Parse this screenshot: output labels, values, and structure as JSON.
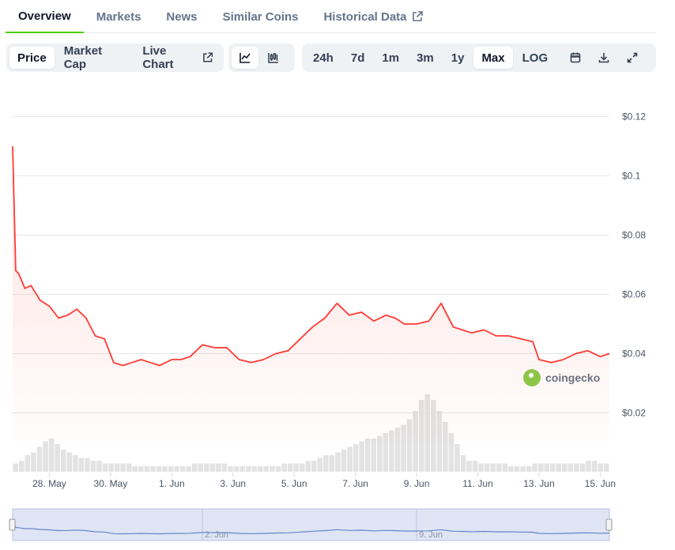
{
  "tabs": [
    {
      "label": "Overview",
      "active": true
    },
    {
      "label": "Markets"
    },
    {
      "label": "News"
    },
    {
      "label": "Similar Coins"
    },
    {
      "label": "Historical Data",
      "external": true
    }
  ],
  "toolbar": {
    "view": [
      {
        "label": "Price",
        "active": true
      },
      {
        "label": "Market Cap"
      },
      {
        "label": "Live Chart",
        "external": true
      }
    ],
    "chart_type_icons": [
      "line-chart-icon",
      "candlestick-chart-icon"
    ],
    "ranges": [
      {
        "label": "24h"
      },
      {
        "label": "7d"
      },
      {
        "label": "1m"
      },
      {
        "label": "3m"
      },
      {
        "label": "1y"
      },
      {
        "label": "Max",
        "active": true
      },
      {
        "label": "LOG"
      }
    ],
    "action_icons": [
      "calendar-icon",
      "download-icon",
      "expand-icon"
    ]
  },
  "watermark": "coingecko",
  "colors": {
    "line": "#ff3a33",
    "accent": "#4bcc00",
    "navigator": "#6983c8"
  },
  "chart_data": {
    "type": "line",
    "ylim": [
      0.01,
      0.13
    ],
    "yticks": [
      "$0.12",
      "$0.1",
      "$0.08",
      "$0.06",
      "$0.04",
      "$0.02"
    ],
    "yvals": [
      0.12,
      0.1,
      0.08,
      0.06,
      0.04,
      0.02
    ],
    "xticks": [
      "28. May",
      "30. May",
      "1. Jun",
      "3. Jun",
      "5. Jun",
      "7. Jun",
      "9. Jun",
      "11. Jun",
      "13. Jun",
      "15. Jun"
    ],
    "xtick_days": [
      1,
      3,
      5,
      7,
      9,
      11,
      13,
      15,
      17,
      19
    ],
    "xrange_days": [
      -0.2,
      19.3
    ],
    "nav_labels": [
      {
        "label": "2. Jun",
        "day": 6
      },
      {
        "label": "9. Jun",
        "day": 13
      }
    ],
    "series": [
      {
        "x": [
          -0.2,
          -0.1,
          0,
          0.2,
          0.4,
          0.7,
          1.0,
          1.3,
          1.6,
          1.9,
          2.2,
          2.5,
          2.8,
          3.1,
          3.4,
          3.7,
          4.0,
          4.3,
          4.6,
          4.8,
          5.0,
          5.3,
          5.6,
          6.0,
          6.4,
          6.8,
          7.2,
          7.6,
          8.0,
          8.4,
          8.8,
          9.2,
          9.6,
          10.0,
          10.4,
          10.8,
          11.2,
          11.6,
          12.0,
          12.3,
          12.6,
          13.0,
          13.4,
          13.8,
          14.2,
          14.5,
          14.8,
          15.2,
          15.6,
          16.0,
          16.4,
          16.8,
          17.0,
          17.4,
          17.8,
          18.2,
          18.6,
          19.0,
          19.3
        ],
        "y": [
          0.11,
          0.068,
          0.067,
          0.062,
          0.063,
          0.058,
          0.056,
          0.052,
          0.053,
          0.055,
          0.052,
          0.046,
          0.045,
          0.037,
          0.036,
          0.037,
          0.038,
          0.037,
          0.036,
          0.037,
          0.038,
          0.038,
          0.039,
          0.043,
          0.042,
          0.042,
          0.038,
          0.037,
          0.038,
          0.04,
          0.041,
          0.045,
          0.049,
          0.052,
          0.057,
          0.053,
          0.054,
          0.051,
          0.053,
          0.052,
          0.05,
          0.05,
          0.051,
          0.057,
          0.049,
          0.048,
          0.047,
          0.048,
          0.046,
          0.046,
          0.045,
          0.044,
          0.038,
          0.037,
          0.038,
          0.04,
          0.041,
          0.039,
          0.04
        ]
      }
    ],
    "volume": [
      3,
      4,
      6,
      7,
      9,
      11,
      12,
      10,
      8,
      7,
      6,
      5,
      5,
      4,
      4,
      3,
      3,
      3,
      3,
      3,
      2,
      2,
      2,
      2,
      2,
      2,
      2,
      2,
      2,
      2,
      3,
      3,
      3,
      3,
      3,
      3,
      2,
      2,
      2,
      2,
      2,
      2,
      2,
      2,
      2,
      3,
      3,
      3,
      3,
      4,
      4,
      5,
      6,
      6,
      7,
      8,
      9,
      10,
      11,
      12,
      12,
      13,
      14,
      15,
      16,
      17,
      19,
      22,
      26,
      28,
      26,
      22,
      18,
      14,
      10,
      6,
      4,
      4,
      3,
      3,
      3,
      3,
      3,
      2,
      2,
      2,
      2,
      3,
      3,
      3,
      3,
      3,
      3,
      3,
      3,
      3,
      4,
      4,
      3,
      3
    ]
  }
}
